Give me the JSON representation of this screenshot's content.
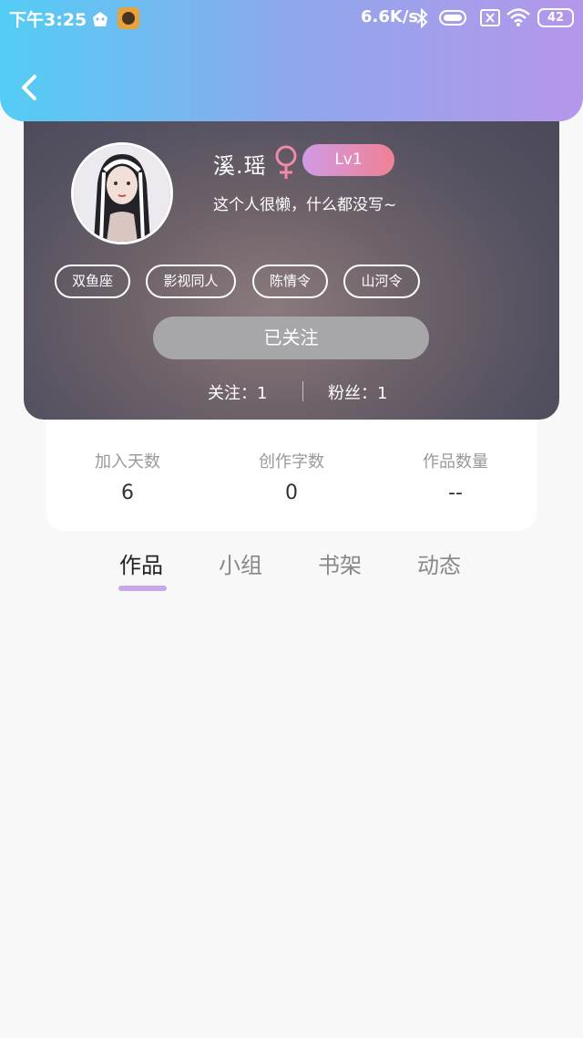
{
  "status_bar": {
    "time": "下午3:25",
    "network_speed": "6.6K/s",
    "battery": "42",
    "icons": [
      "app-notification-icon",
      "app-game-icon",
      "bluetooth-icon",
      "toggle-icon",
      "sim-off-icon",
      "wifi-icon",
      "battery-icon"
    ]
  },
  "header": {
    "back_icon": "chevron-left-icon",
    "gradient": [
      "#53cdf5",
      "#b596ea"
    ]
  },
  "profile": {
    "name": "溪.瑶",
    "gender_icon": "female-icon",
    "level": "Lv1",
    "bio": "这个人很懒，什么都没写~",
    "tags": [
      "双鱼座",
      "影视同人",
      "陈情令",
      "山河令"
    ],
    "follow_button": "已关注",
    "following": "关注：1",
    "followers": "粉丝：1"
  },
  "stats": [
    {
      "label": "加入天数",
      "value": "6"
    },
    {
      "label": "创作字数",
      "value": "0"
    },
    {
      "label": "作品数量",
      "value": "--"
    }
  ],
  "tabs": [
    {
      "label": "作品",
      "active": true
    },
    {
      "label": "小组",
      "active": false
    },
    {
      "label": "书架",
      "active": false
    },
    {
      "label": "动态",
      "active": false
    }
  ],
  "colors": {
    "accent": "#c7a8ea",
    "level_badge": [
      "#d09ae6",
      "#f08193"
    ],
    "female": "#f08aa8"
  }
}
